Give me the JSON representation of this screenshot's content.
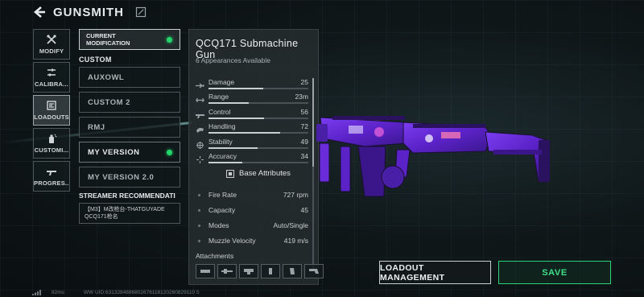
{
  "header": {
    "title": "GUNSMITH",
    "back_icon": "back-arrow-icon"
  },
  "rail": [
    {
      "label": "MODIFY",
      "icon": "wrench-icon",
      "active": false
    },
    {
      "label": "CALIBRA...",
      "icon": "sliders-icon",
      "active": false
    },
    {
      "label": "LOADOUTS",
      "icon": "loadout-icon",
      "active": true
    },
    {
      "label": "CUSTOMI...",
      "icon": "spray-icon",
      "active": false
    },
    {
      "label": "PROGRES...",
      "icon": "rifle-icon",
      "active": false
    }
  ],
  "current_mod": {
    "label_line1": "CURRENT",
    "label_line2": "MODIFICATION"
  },
  "custom": {
    "heading": "CUSTOM",
    "presets": [
      {
        "label": "AUXOWL",
        "selected": false
      },
      {
        "label": "CUSTOM 2",
        "selected": false
      },
      {
        "label": "RMJ",
        "selected": false
      },
      {
        "label": "MY VERSION",
        "selected": true
      },
      {
        "label": "MY VERSION 2.0",
        "selected": false
      }
    ]
  },
  "streamer": {
    "heading": "STREAMER RECOMMENDATI",
    "line1": "【M3】M改枪台-THATGUYADE",
    "line2": "QCQ171枪名"
  },
  "weapon": {
    "name": "QCQ171 Submachine Gun",
    "appearances": "6 Appearances Available",
    "stats": [
      {
        "name": "Damage",
        "value": "25",
        "fill": 0.55,
        "icon": "damage-icon"
      },
      {
        "name": "Range",
        "value": "23m",
        "fill": 0.4,
        "icon": "range-icon"
      },
      {
        "name": "Control",
        "value": "56",
        "fill": 0.56,
        "icon": "control-icon"
      },
      {
        "name": "Handling",
        "value": "72",
        "fill": 0.72,
        "icon": "handling-icon"
      },
      {
        "name": "Stability",
        "value": "49",
        "fill": 0.49,
        "icon": "stability-icon"
      },
      {
        "name": "Accuracy",
        "value": "34",
        "fill": 0.34,
        "icon": "accuracy-icon"
      }
    ],
    "base_attributes_label": "Base Attributes",
    "attributes": [
      {
        "name": "Fire Rate",
        "value": "727 rpm"
      },
      {
        "name": "Capacity",
        "value": "45"
      },
      {
        "name": "Modes",
        "value": "Auto/Single"
      },
      {
        "name": "Muzzle Velocity",
        "value": "419 m/s"
      }
    ],
    "attachments_label": "Attachments",
    "attachment_slots": [
      "muzzle-icon",
      "barrel-icon",
      "optic-icon",
      "grip-icon",
      "magazine-icon",
      "stock-icon"
    ]
  },
  "buttons": {
    "loadout": "LOADOUT MANAGEMENT",
    "save": "SAVE"
  },
  "footer": {
    "ping": "82ms",
    "uid": "WW UID:6313284886802676116120260829110 5"
  },
  "colors": {
    "accent_green": "#2fd17a",
    "indicator": "#22d66a",
    "skin_purple": "#6a2bd9"
  }
}
